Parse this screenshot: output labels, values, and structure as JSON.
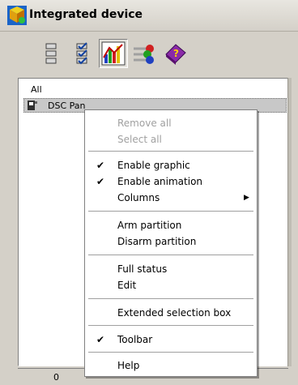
{
  "window": {
    "title": "Integrated device",
    "title_icon": "integrated-device-icon"
  },
  "toolbar": {
    "buttons": [
      {
        "name": "list-view-icon",
        "pressed": false
      },
      {
        "name": "checklist-icon",
        "pressed": false
      },
      {
        "name": "graph-view-icon",
        "pressed": true
      },
      {
        "name": "animation-icon",
        "pressed": false
      },
      {
        "name": "help-book-icon",
        "pressed": false
      }
    ]
  },
  "tree": {
    "all_label": "All",
    "selected_item": {
      "label": "DSC Pan",
      "icon": "panel-device-icon"
    }
  },
  "status": {
    "count": "0"
  },
  "context_menu": {
    "items": [
      {
        "label": "Remove all",
        "disabled": true,
        "checked": false,
        "submenu": false
      },
      {
        "label": "Select all",
        "disabled": true,
        "checked": false,
        "submenu": false
      },
      {
        "label": "Enable graphic",
        "disabled": false,
        "checked": true,
        "submenu": false
      },
      {
        "label": "Enable animation",
        "disabled": false,
        "checked": true,
        "submenu": false
      },
      {
        "label": "Columns",
        "disabled": false,
        "checked": false,
        "submenu": true
      },
      {
        "label": "Arm partition",
        "disabled": false,
        "checked": false,
        "submenu": false
      },
      {
        "label": "Disarm partition",
        "disabled": false,
        "checked": false,
        "submenu": false
      },
      {
        "label": "Full status",
        "disabled": false,
        "checked": false,
        "submenu": false
      },
      {
        "label": "Edit",
        "disabled": false,
        "checked": false,
        "submenu": false
      },
      {
        "label": "Extended selection box",
        "disabled": false,
        "checked": false,
        "submenu": false
      },
      {
        "label": "Toolbar",
        "disabled": false,
        "checked": true,
        "submenu": false
      },
      {
        "label": "Help",
        "disabled": false,
        "checked": false,
        "submenu": false
      }
    ],
    "check_glyph": "✔",
    "submenu_glyph": "▶"
  },
  "colors": {
    "chrome": "#d4d0c8",
    "selected_row": "#c8c8c8",
    "disabled_text": "#a0a0a0"
  }
}
